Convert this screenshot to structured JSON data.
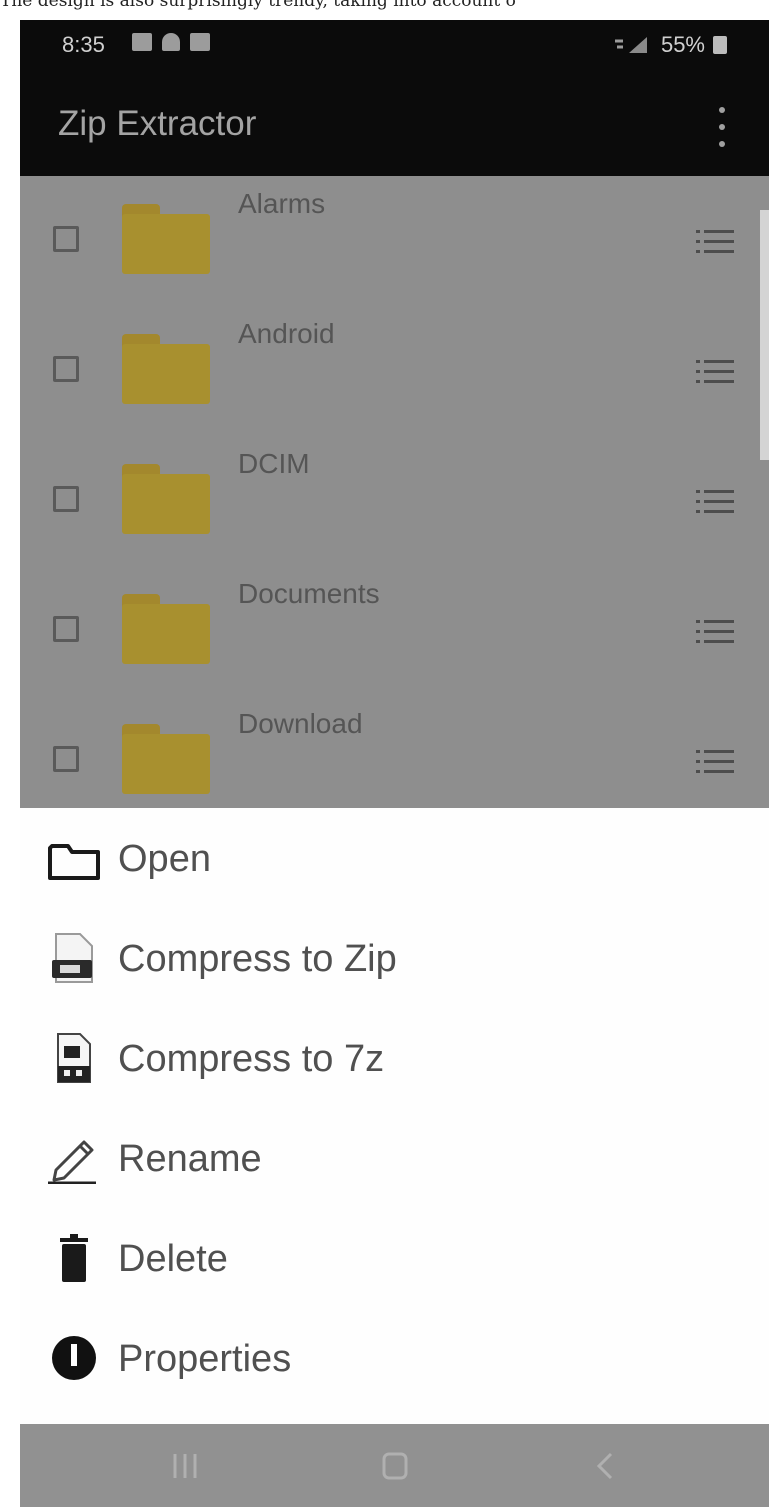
{
  "caption": {
    "text": "The design is also surprisingly trendy, taking into account o"
  },
  "status_bar": {
    "time": "8:35",
    "right_text": "55%"
  },
  "app_bar": {
    "title": "Zip Extractor",
    "overflow_icon": "more-vert-icon"
  },
  "file_list": {
    "items": [
      {
        "name": "Alarms"
      },
      {
        "name": "Android"
      },
      {
        "name": "DCIM"
      },
      {
        "name": "Documents"
      },
      {
        "name": "Download"
      }
    ]
  },
  "context_menu": {
    "items": [
      {
        "label": "Open",
        "icon": "folder-open-icon"
      },
      {
        "label": "Compress to Zip",
        "icon": "zip-file-icon"
      },
      {
        "label": "Compress to 7z",
        "icon": "7z-file-icon"
      },
      {
        "label": "Rename",
        "icon": "pencil-icon"
      },
      {
        "label": "Delete",
        "icon": "trash-icon"
      },
      {
        "label": "Properties",
        "icon": "info-icon"
      }
    ]
  },
  "nav_bar": {
    "buttons": [
      "recents-icon",
      "home-icon",
      "back-icon"
    ]
  },
  "colors": {
    "folder": "#a8902f",
    "scrim": "#8e8e8e",
    "sheet_background": "#fefefe",
    "app_bar": "#0b0b0b"
  }
}
